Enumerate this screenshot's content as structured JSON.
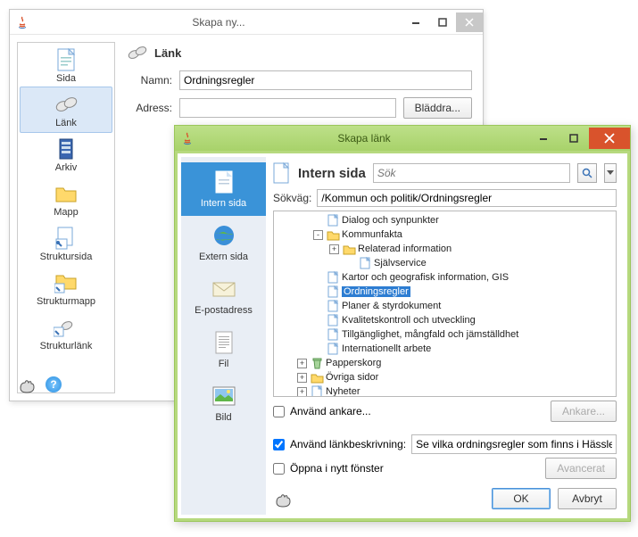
{
  "win1": {
    "title": "Skapa ny...",
    "header": "Länk",
    "name_label": "Namn:",
    "name_value": "Ordningsregler",
    "addr_label": "Adress:",
    "addr_value": "",
    "browse_btn": "Bläddra...",
    "sidebar": [
      {
        "label": "Sida",
        "icon": "page-icon"
      },
      {
        "label": "Länk",
        "icon": "link-icon",
        "selected": true
      },
      {
        "label": "Arkiv",
        "icon": "archive-icon"
      },
      {
        "label": "Mapp",
        "icon": "folder-icon"
      },
      {
        "label": "Struktursida",
        "icon": "struct-page-icon"
      },
      {
        "label": "Strukturmapp",
        "icon": "struct-folder-icon"
      },
      {
        "label": "Strukturlänk",
        "icon": "struct-link-icon"
      }
    ]
  },
  "win2": {
    "title": "Skapa länk",
    "header": "Intern sida",
    "search_placeholder": "Sök",
    "path_label": "Sökväg:",
    "path_value": "/Kommun och politik/Ordningsregler",
    "sidebar": [
      {
        "label": "Intern sida",
        "icon": "page-icon",
        "selected": true
      },
      {
        "label": "Extern sida",
        "icon": "globe-icon"
      },
      {
        "label": "E-postadress",
        "icon": "mail-icon"
      },
      {
        "label": "Fil",
        "icon": "file-icon"
      },
      {
        "label": "Bild",
        "icon": "image-icon"
      }
    ],
    "tree": [
      {
        "depth": 2,
        "icon": "page",
        "label": "Dialog och synpunkter"
      },
      {
        "depth": 2,
        "tw": "-",
        "icon": "folder",
        "label": "Kommunfakta"
      },
      {
        "depth": 3,
        "tw": "+",
        "icon": "folder",
        "label": "Relaterad information"
      },
      {
        "depth": 4,
        "icon": "page",
        "label": "Självservice"
      },
      {
        "depth": 2,
        "icon": "page",
        "label": "Kartor och geografisk information, GIS"
      },
      {
        "depth": 2,
        "icon": "page",
        "label": "Ordningsregler",
        "selected": true
      },
      {
        "depth": 2,
        "icon": "page",
        "label": "Planer & styrdokument"
      },
      {
        "depth": 2,
        "icon": "page",
        "label": "Kvalitetskontroll och utveckling"
      },
      {
        "depth": 2,
        "icon": "page",
        "label": "Tillgänglighet, mångfald och jämställdhet"
      },
      {
        "depth": 2,
        "icon": "page",
        "label": "Internationellt arbete"
      },
      {
        "depth": 1,
        "tw": "+",
        "icon": "trash",
        "label": "Papperskorg"
      },
      {
        "depth": 1,
        "tw": "+",
        "icon": "folder",
        "label": "Övriga sidor"
      },
      {
        "depth": 1,
        "tw": "+",
        "icon": "page",
        "label": "Nyheter"
      }
    ],
    "use_anchor_label": "Använd ankare...",
    "anchor_btn": "Ankare...",
    "use_desc_label": "Använd länkbeskrivning:",
    "desc_value": "Se vilka ordningsregler som finns i Hässleholm",
    "open_new_label": "Öppna i nytt fönster",
    "advanced_btn": "Avancerat",
    "ok_btn": "OK",
    "cancel_btn": "Avbryt"
  }
}
